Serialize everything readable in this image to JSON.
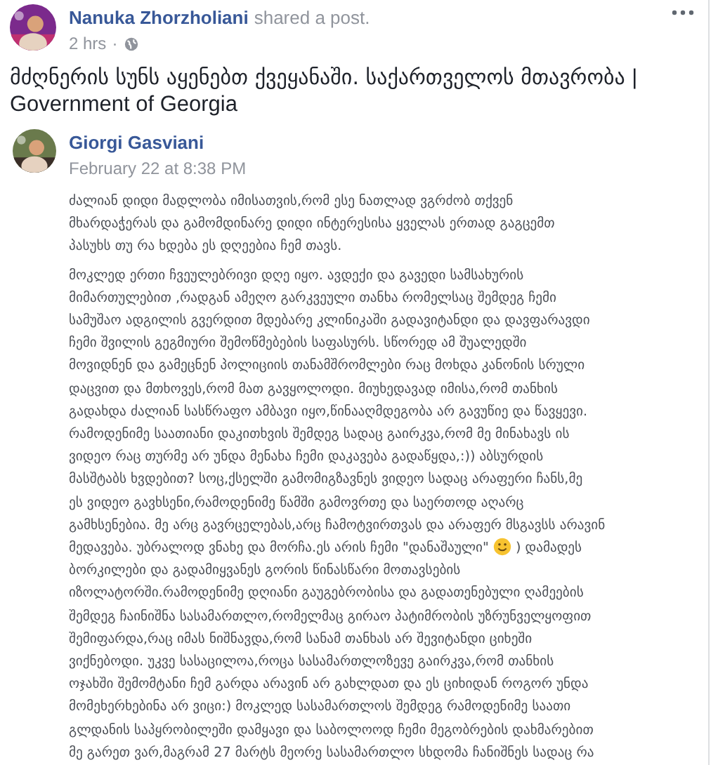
{
  "share_header": {
    "author": "Nanuka Zhorzholiani",
    "action": "shared a post.",
    "time": "2 hrs",
    "separator": "·"
  },
  "shared_title": "მძღნერის სუნს აყენებთ ქვეყანაში. საქართველოს მთავრობა | Government of Georgia",
  "original_post": {
    "author": "Giorgi Gasviani",
    "date": "February 22 at 8:38 PM",
    "paragraphs": [
      [
        [
          "ძალიან დიდი მადლობა იმისათვის,რომ ესე ნათლად ვგრძობ თქვენ"
        ],
        [
          "მხარდაჭერას და გამომდინარე დიდი ინტერესისა ყველას ერთად გაგცემთ"
        ],
        [
          "პასუხს თუ რა ხდება ეს დღეებია ჩემ თავს."
        ]
      ],
      [
        [
          "მოკლედ ერთი ჩვეულებრივი დღე იყო. ავდექი და გავედი სამსახურის"
        ],
        [
          "მიმართულებით ,რადგან ამეღო გარკვეული თანხა რომელსაც შემდეგ ჩემი"
        ],
        [
          "სამუშაო ადგილის გვერდით მდებარე კლინიკაში გადავიტანდი და დავფარავდი"
        ],
        [
          "ჩემი შვილის გეგმიური შემოწმებების საფასურს. სწორედ ამ შუალედში"
        ],
        [
          "მოვიდნენ და გამეცნენ პოლიციის თანამშრომლები რაც მოხდა კანონის სრული"
        ],
        [
          "დაცვით და მთხოვეს,რომ მათ გავყოლოდი. მიუხედავად იმისა,რომ თანხის"
        ],
        [
          "გადახდა ძალიან სასწრაფო ამბავი იყო,წინააღმდეგობა არ გავუწიე და წავყევი."
        ],
        [
          "რამოდენიმე საათიანი დაკითხვის შემდეგ სადაც გაირკვა,რომ მე მინახავს ის"
        ],
        [
          "ვიდეო რაც თურმე არ უნდა მენახა ჩემი დაკავება გადაწყდა,:)) აბსურდის"
        ],
        [
          "მასშტაბს ხვდებით? სოც,ქსელში გამომიგზავნეს ვიდეო სადაც არაფერი ჩანს,მე"
        ],
        [
          "ეს ვიდეო გავხსენი,რამოდენიმე წამში გამოვრთე და საერთოდ აღარც"
        ],
        [
          "გამხსენებია. მე არც გავრცელებას,არც ჩამოტვირთვას და არაფერ მსგავსს არავინ"
        ],
        [
          "მედავება. უბრალოდ ვნახე და მორჩა.ეს არის ჩემი \"დანაშაული\"",
          ") დამადეს"
        ],
        [
          "ბორკილები და გადამიყვანეს გორის წინასწარი მოთავსების"
        ],
        [
          "იზოლატორში.რამოდენიმე დღიანი გაუგებრობისა და გადათენებული ღამეების"
        ],
        [
          "შემდეგ ჩაინიშნა სასამართლო,რომელმაც გირაო პატიმრობის უზრუნველყოფით"
        ],
        [
          "შემიფარდა,რაც იმას ნიშნავდა,რომ სანამ თანხას არ შევიტანდი ციხეში"
        ],
        [
          "ვიქნებოდი. უკვე სასაცილოა,როცა სასამართლოზევე გაირკვა,რომ თანხის"
        ],
        [
          "ოჯახში შემომტანი ჩემ გარდა არავინ არ გახლდათ და ეს ციხიდან როგორ უნდა"
        ],
        [
          "მომეხერხებინა არ ვიცი:) მოკლედ სასამართლოს შემდეგ რამოდენიმე საათი"
        ],
        [
          "გლდანის საპყრობილეში დამყავი და საბოლოოდ ჩემი მეგობრების დახმარებით"
        ],
        [
          "მე გარეთ ვარ,მაგრამ 27 მარტს მეორე სასამართლო სხდომა ჩანიშნეს სადაც რა"
        ]
      ]
    ]
  }
}
